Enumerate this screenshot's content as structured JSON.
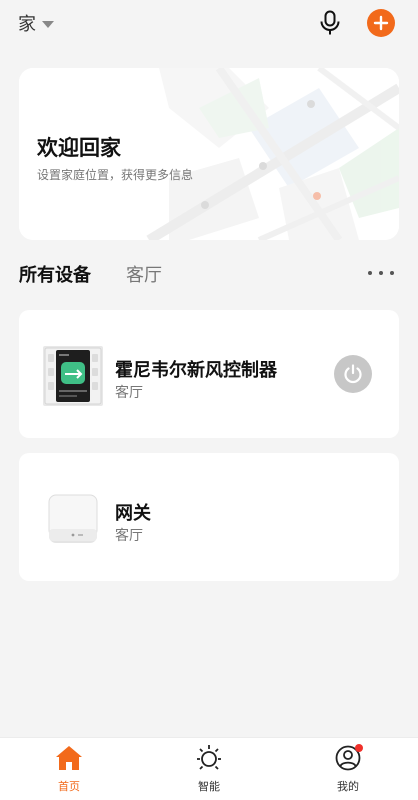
{
  "header": {
    "home_name": "家",
    "icons": {
      "mic": "microphone-icon",
      "add": "plus-icon"
    }
  },
  "welcome": {
    "title": "欢迎回家",
    "subtitle": "设置家庭位置，获得更多信息"
  },
  "tabs": {
    "items": [
      {
        "label": "所有设备",
        "active": true
      },
      {
        "label": "客厅",
        "active": false
      }
    ],
    "more_icon": "more-dots-icon"
  },
  "devices": [
    {
      "name": "霍尼韦尔新风控制器",
      "room": "客厅",
      "icon": "fresh-air-controller-icon",
      "has_power": true
    },
    {
      "name": "网关",
      "room": "客厅",
      "icon": "gateway-icon",
      "has_power": false
    }
  ],
  "bottom_nav": {
    "items": [
      {
        "label": "首页",
        "icon": "home-icon",
        "active": true
      },
      {
        "label": "智能",
        "icon": "sun-icon",
        "active": false
      },
      {
        "label": "我的",
        "icon": "user-icon",
        "active": false,
        "badge": true
      }
    ]
  },
  "colors": {
    "accent": "#f26a1b",
    "background": "#f4f4f4",
    "card": "#ffffff",
    "badge": "#f0302a"
  }
}
